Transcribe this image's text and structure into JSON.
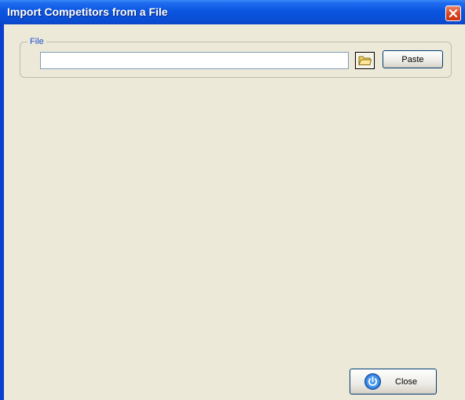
{
  "window": {
    "title": "Import Competitors from a File"
  },
  "file_group": {
    "legend": "File",
    "path_value": "",
    "paste_label": "Paste"
  },
  "footer": {
    "close_label": "Close"
  },
  "icons": {
    "window_close": "close-x-icon",
    "browse": "folder-icon",
    "close": "power-icon"
  },
  "colors": {
    "titlebar": "#0a4fd6",
    "dialog_background": "#ece9d8",
    "legend_text": "#1a4fd0",
    "window_close_button": "#d9441e"
  }
}
